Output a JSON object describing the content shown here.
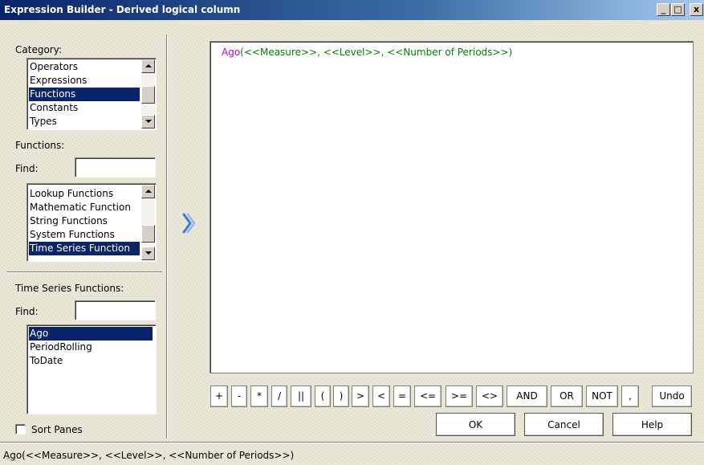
{
  "window": {
    "title": "Expression Builder - Derived logical column",
    "controls": {
      "minimize": "_",
      "maximize": "□",
      "close": "x"
    }
  },
  "category_panel": {
    "label": "Category:",
    "items": [
      "Operators",
      "Expressions",
      "Functions",
      "Constants",
      "Types"
    ],
    "selected": "Functions"
  },
  "functions_panel": {
    "label": "Functions:",
    "find_label": "Find:",
    "find_value": "",
    "items": [
      "Lookup Functions",
      "Mathematic Function",
      "String Functions",
      "System Functions",
      "Time Series Function"
    ],
    "selected": "Time Series Function"
  },
  "subfunctions_panel": {
    "label": "Time Series Functions:",
    "find_label": "Find:",
    "find_value": "",
    "items": [
      "Ago",
      "PeriodRolling",
      "ToDate"
    ],
    "selected": "Ago"
  },
  "sort_panes": {
    "label": "Sort Panes",
    "checked": false
  },
  "insert_arrow": {
    "icon": "double-chevron-right-icon",
    "glyph": "»"
  },
  "editor": {
    "function_name": "Ago",
    "args_text": "(<<Measure>>, <<Level>>, <<Number of Periods>>)",
    "colors": {
      "function_name": "#c000c0",
      "args": "#008000"
    }
  },
  "operators": [
    "+",
    "-",
    "*",
    "/",
    "||",
    "(",
    ")",
    ">",
    "<",
    "=",
    "<=",
    ">=",
    "<>",
    "AND",
    "OR",
    "NOT",
    ",",
    "Undo"
  ],
  "dialog_buttons": {
    "ok": "OK",
    "cancel": "Cancel",
    "help": "Help"
  },
  "status": {
    "text": "Ago(<<Measure>>, <<Level>>, <<Number of Periods>>)"
  },
  "colors": {
    "selection": "#0a246a",
    "title_start": "#0a246a",
    "title_end": "#a6caf0",
    "arrow": "#3a7bd5"
  }
}
